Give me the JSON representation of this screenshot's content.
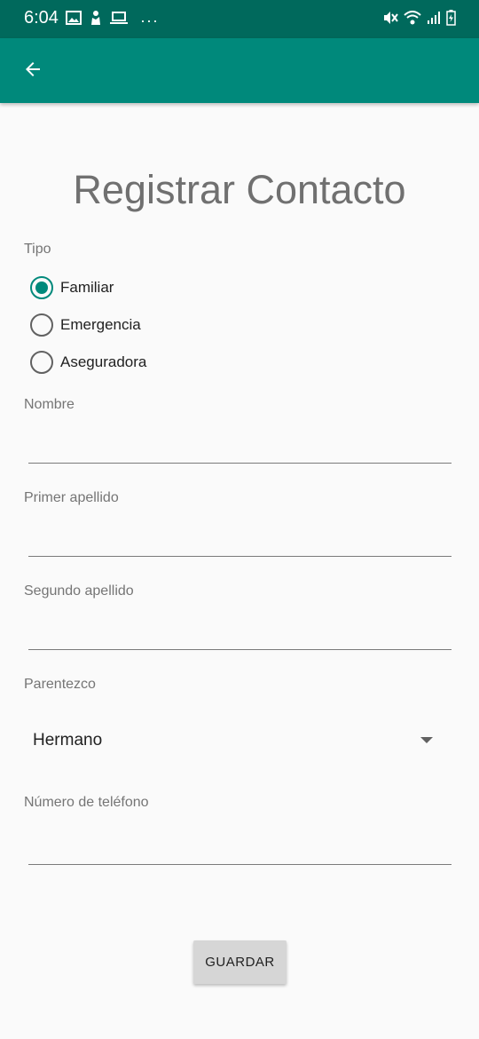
{
  "status_bar": {
    "time": "6:04",
    "dots": "···",
    "left_icons": [
      "image-icon",
      "hand-icon",
      "laptop-icon"
    ],
    "right_icons": [
      "mute-icon",
      "wifi-icon",
      "signal-icon",
      "battery-icon"
    ]
  },
  "app_bar": {
    "back_icon": "arrow-back-icon",
    "color": "#00897b",
    "status_color": "#00695c"
  },
  "title": "Registrar Contacto",
  "tipo": {
    "label": "Tipo",
    "options": [
      {
        "label": "Familiar",
        "checked": true
      },
      {
        "label": "Emergencia",
        "checked": false
      },
      {
        "label": "Aseguradora",
        "checked": false
      }
    ]
  },
  "fields": {
    "nombre": {
      "label": "Nombre",
      "value": ""
    },
    "primer_apellido": {
      "label": "Primer apellido",
      "value": ""
    },
    "segundo_apellido": {
      "label": "Segundo apellido",
      "value": ""
    },
    "parentezco": {
      "label": "Parentezco",
      "value": "Hermano"
    },
    "telefono": {
      "label": "Número de teléfono",
      "value": ""
    }
  },
  "save_button": "GUARDAR"
}
